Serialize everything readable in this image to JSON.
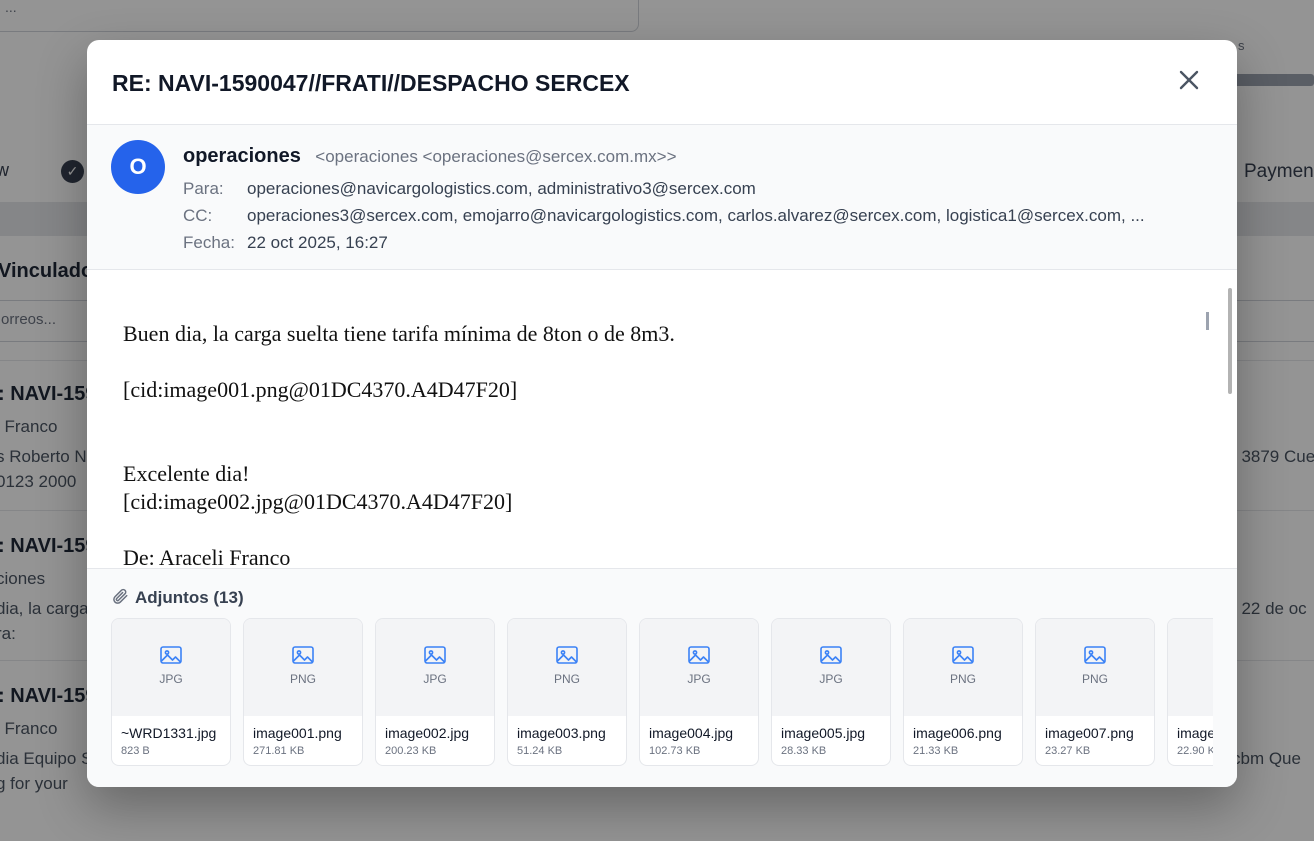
{
  "background": {
    "search_placeholder": "...",
    "top_right_note": "s",
    "tab_left": "w",
    "tab_right": "Payment",
    "section_title": "Vinculado",
    "filter_placeholder": "orreos...",
    "items": [
      {
        "title": ": NAVI-159",
        "line1": "i Franco",
        "line2": "s Roberto N",
        "line3": "0123 2000",
        "right": ": 3879 Cue"
      },
      {
        "title": ": NAVI-159",
        "line1": "ciones",
        "line2": "dia, la carga",
        "line3": "ra:",
        "right": ", 22 de oc"
      },
      {
        "title": ": NAVI-159",
        "line1": "i Franco",
        "line2": "dia Equipo S",
        "line3": "g for your",
        "right": "cbm Que"
      }
    ]
  },
  "modal": {
    "title": "RE: NAVI-1590047//FRATI//DESPACHO SERCEX",
    "avatar_letter": "O",
    "sender_name": "operaciones",
    "sender_email": "<operaciones <operaciones@sercex.com.mx>>",
    "to_label": "Para:",
    "to_value": "operaciones@navicargologistics.com, administrativo3@sercex.com",
    "cc_label": "CC:",
    "cc_value": "operaciones3@sercex.com, emojarro@navicargologistics.com, carlos.alvarez@sercex.com, logistica1@sercex.com, ...",
    "date_label": "Fecha:",
    "date_value": "22 oct 2025, 16:27",
    "body": {
      "line1": "Buen dia, la carga suelta tiene tarifa mínima de 8ton o de 8m3.",
      "line2": "[cid:image001.png@01DC4370.A4D47F20]",
      "line3": "Excelente dia!",
      "line4": "[cid:image002.jpg@01DC4370.A4D47F20]",
      "line5": "De: Araceli Franco"
    },
    "attachments_label": "Adjuntos (13)",
    "attachments": [
      {
        "ext": "JPG",
        "name": "~WRD1331.jpg",
        "size": "823 B"
      },
      {
        "ext": "PNG",
        "name": "image001.png",
        "size": "271.81 KB"
      },
      {
        "ext": "JPG",
        "name": "image002.jpg",
        "size": "200.23 KB"
      },
      {
        "ext": "PNG",
        "name": "image003.png",
        "size": "51.24 KB"
      },
      {
        "ext": "JPG",
        "name": "image004.jpg",
        "size": "102.73 KB"
      },
      {
        "ext": "JPG",
        "name": "image005.jpg",
        "size": "28.33 KB"
      },
      {
        "ext": "PNG",
        "name": "image006.png",
        "size": "21.33 KB"
      },
      {
        "ext": "PNG",
        "name": "image007.png",
        "size": "23.27 KB"
      },
      {
        "ext": "",
        "name": "image",
        "size": "22.90 K"
      }
    ]
  },
  "colors": {
    "avatar": "#2563eb",
    "icon_blue": "#3b82f6",
    "overlay": "rgba(0,0,0,0.42)"
  }
}
